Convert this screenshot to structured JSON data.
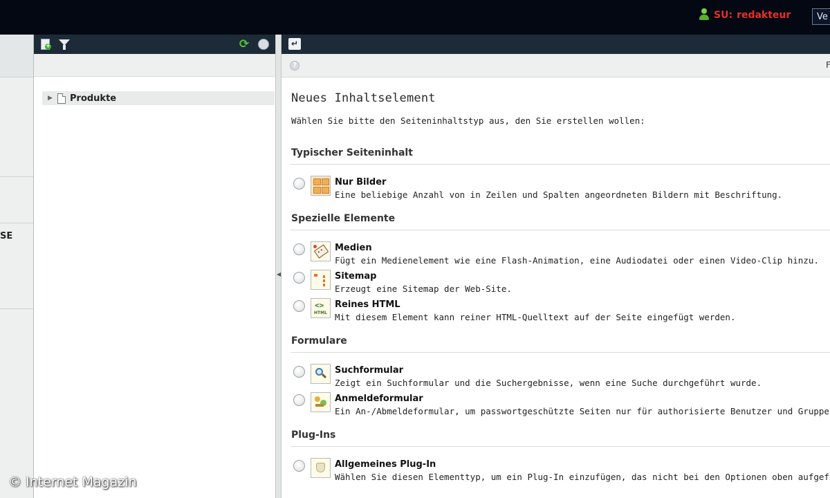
{
  "header": {
    "user_prefix": "SU:",
    "user_name": "redakteur",
    "button_label": "Ve",
    "user_color": "#e8302a"
  },
  "left_nav": {
    "partial_label": "SE"
  },
  "page_tree": {
    "toolbar_icons": [
      "new-page-icon",
      "filter-icon",
      "refresh-icon",
      "globe-icon"
    ],
    "root_item": "Produkte"
  },
  "main": {
    "toolbar_icons": [
      "back-icon",
      "help-icon"
    ],
    "sub_right_text": "F",
    "heading": "Neues Inhaltselement",
    "intro": "Wählen Sie bitte den Seiteninhaltstyp aus, den Sie erstellen wollen:",
    "sections": [
      {
        "title": "Typischer Seiteninhalt",
        "options": [
          {
            "title": "Nur Bilder",
            "description": "Eine beliebige Anzahl von in Zeilen und Spalten angeordneten Bildern mit Beschriftung.",
            "icon": "images-icon"
          }
        ]
      },
      {
        "title": "Spezielle Elemente",
        "options": [
          {
            "title": "Medien",
            "description": "Fügt ein Medienelement wie eine Flash-Animation, eine Audiodatei oder einen Video-Clip hinzu.",
            "icon": "media-icon"
          },
          {
            "title": "Sitemap",
            "description": "Erzeugt eine Sitemap der Web-Site.",
            "icon": "sitemap-icon"
          },
          {
            "title": "Reines HTML",
            "description": "Mit diesem Element kann reiner HTML-Quelltext auf der Seite eingefügt werden.",
            "icon": "html-icon",
            "icon_text": "HTML"
          }
        ]
      },
      {
        "title": "Formulare",
        "options": [
          {
            "title": "Suchformular",
            "description": "Zeigt ein Suchformular und die Suchergebnisse, wenn eine Suche durchgeführt wurde.",
            "icon": "search-form-icon"
          },
          {
            "title": "Anmeldeformular",
            "description": "Ein An-/Abmeldeformular, um passwortgeschützte Seiten nur für authorisierte Benutzer und Gruppen",
            "icon": "login-form-icon"
          }
        ]
      },
      {
        "title": "Plug-Ins",
        "options": [
          {
            "title": "Allgemeines Plug-In",
            "description": "Wählen Sie diesen Elementtyp, um ein Plug-In einzufügen, das nicht bei den Optionen oben aufgeführ",
            "icon": "plugin-icon"
          }
        ]
      }
    ]
  },
  "watermark": "© Internet Magazin"
}
